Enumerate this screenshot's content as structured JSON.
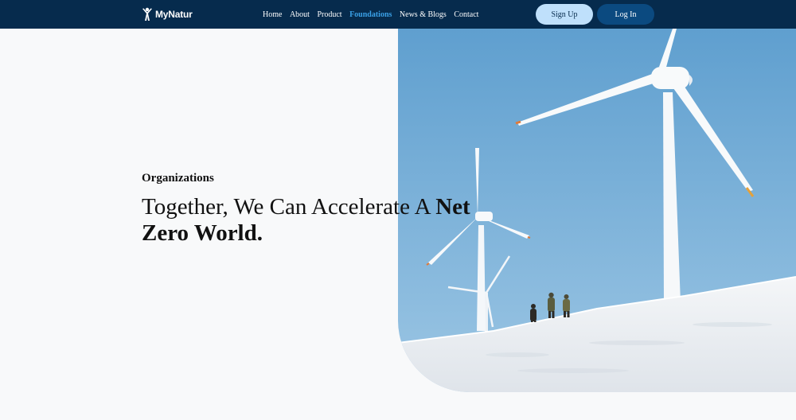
{
  "brand": {
    "name": "MyNatur",
    "logo_icon": "tree-person-icon"
  },
  "nav": {
    "links": [
      {
        "label": "Home"
      },
      {
        "label": "About"
      },
      {
        "label": "Product"
      },
      {
        "label": "Foundations",
        "active": true
      },
      {
        "label": "News & Blogs"
      },
      {
        "label": "Contact"
      }
    ],
    "signup_label": "Sign Up",
    "login_label": "Log In"
  },
  "hero": {
    "eyebrow": "Organizations",
    "headline_regular": "Together, We Can Accelerate A ",
    "headline_bold": "Net Zero World.",
    "image_alt": "wind-turbines-snow-photo"
  },
  "colors": {
    "nav_bg": "#062b4d",
    "active_link": "#3aa0e6",
    "signup_bg": "#bfe0fb",
    "login_bg": "#0b4a80",
    "page_bg": "#f8f9fa",
    "sky": "#6aa6d3"
  }
}
